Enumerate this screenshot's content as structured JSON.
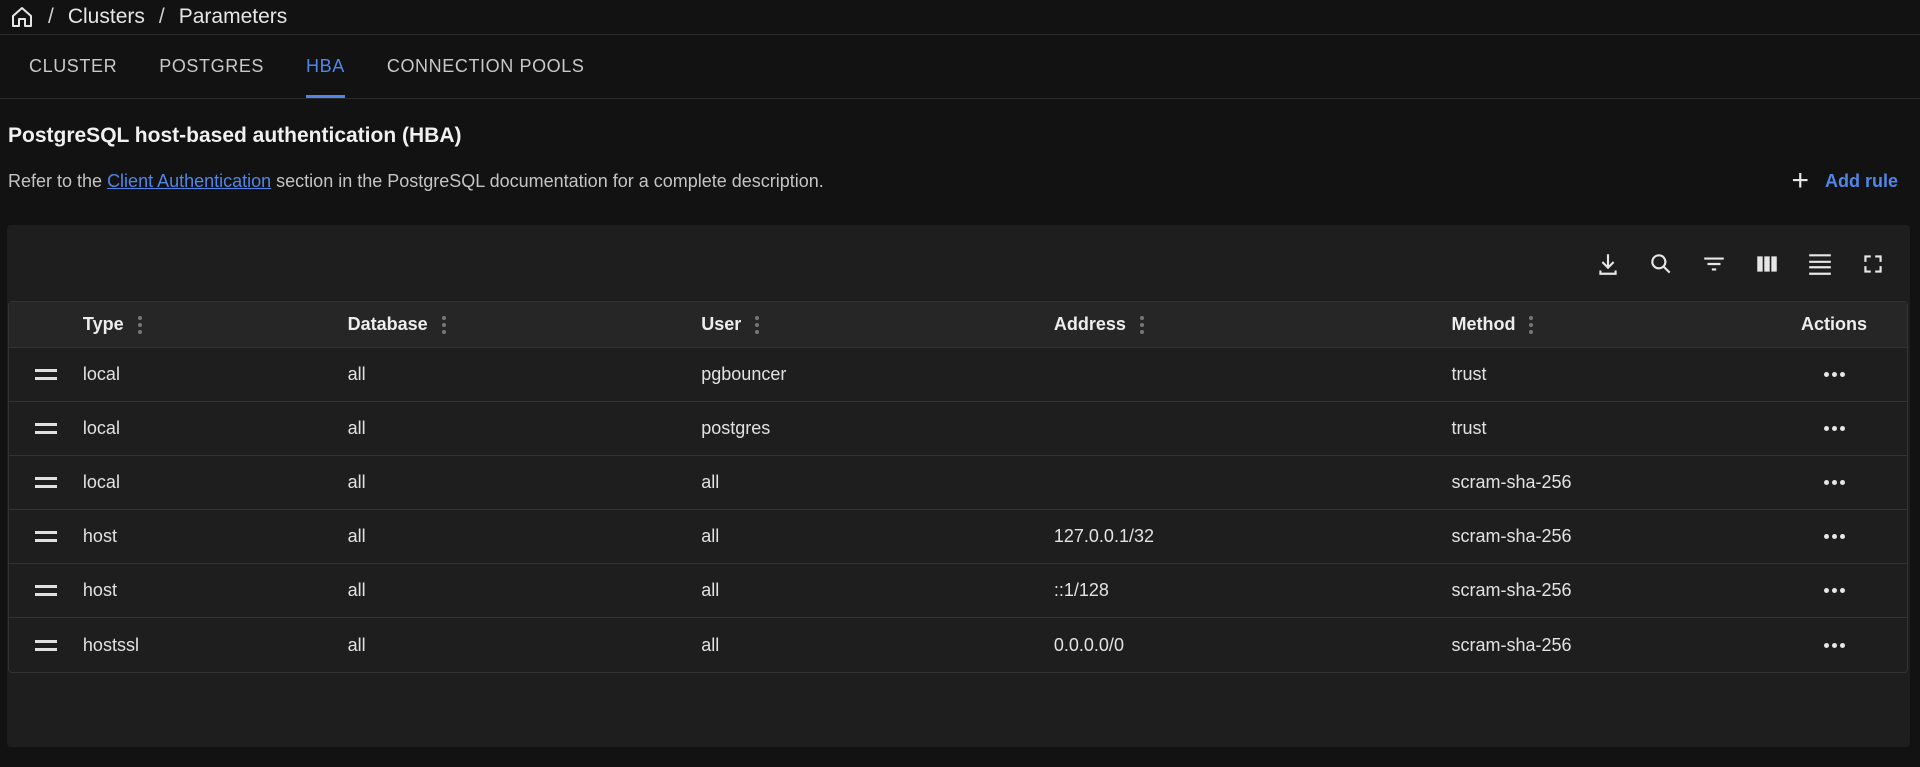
{
  "breadcrumb": {
    "home_icon": "home-icon",
    "separator": "/",
    "items": [
      "Clusters",
      "Parameters"
    ]
  },
  "tabs": [
    {
      "label": "CLUSTER",
      "active": false
    },
    {
      "label": "POSTGRES",
      "active": false
    },
    {
      "label": "HBA",
      "active": true
    },
    {
      "label": "CONNECTION POOLS",
      "active": false
    }
  ],
  "page": {
    "title": "PostgreSQL host-based authentication (HBA)",
    "desc_before": "Refer to the ",
    "desc_link": "Client Authentication",
    "desc_after": " section in the PostgreSQL documentation for a complete description.",
    "add_rule_label": "Add rule"
  },
  "toolbar": {
    "icons": [
      "download-icon",
      "search-icon",
      "filter-icon",
      "columns-icon",
      "density-icon",
      "fullscreen-icon"
    ]
  },
  "table": {
    "headers": {
      "type": "Type",
      "database": "Database",
      "user": "User",
      "address": "Address",
      "method": "Method",
      "actions": "Actions"
    },
    "rows": [
      {
        "type": "local",
        "database": "all",
        "user": "pgbouncer",
        "address": "",
        "method": "trust"
      },
      {
        "type": "local",
        "database": "all",
        "user": "postgres",
        "address": "",
        "method": "trust"
      },
      {
        "type": "local",
        "database": "all",
        "user": "all",
        "address": "",
        "method": "scram-sha-256"
      },
      {
        "type": "host",
        "database": "all",
        "user": "all",
        "address": "127.0.0.1/32",
        "method": "scram-sha-256"
      },
      {
        "type": "host",
        "database": "all",
        "user": "all",
        "address": "::1/128",
        "method": "scram-sha-256"
      },
      {
        "type": "hostssl",
        "database": "all",
        "user": "all",
        "address": "0.0.0.0/0",
        "method": "scram-sha-256"
      }
    ]
  },
  "colors": {
    "accent": "#4f86e8",
    "background": "#121212",
    "panel": "#1e1e1e"
  }
}
